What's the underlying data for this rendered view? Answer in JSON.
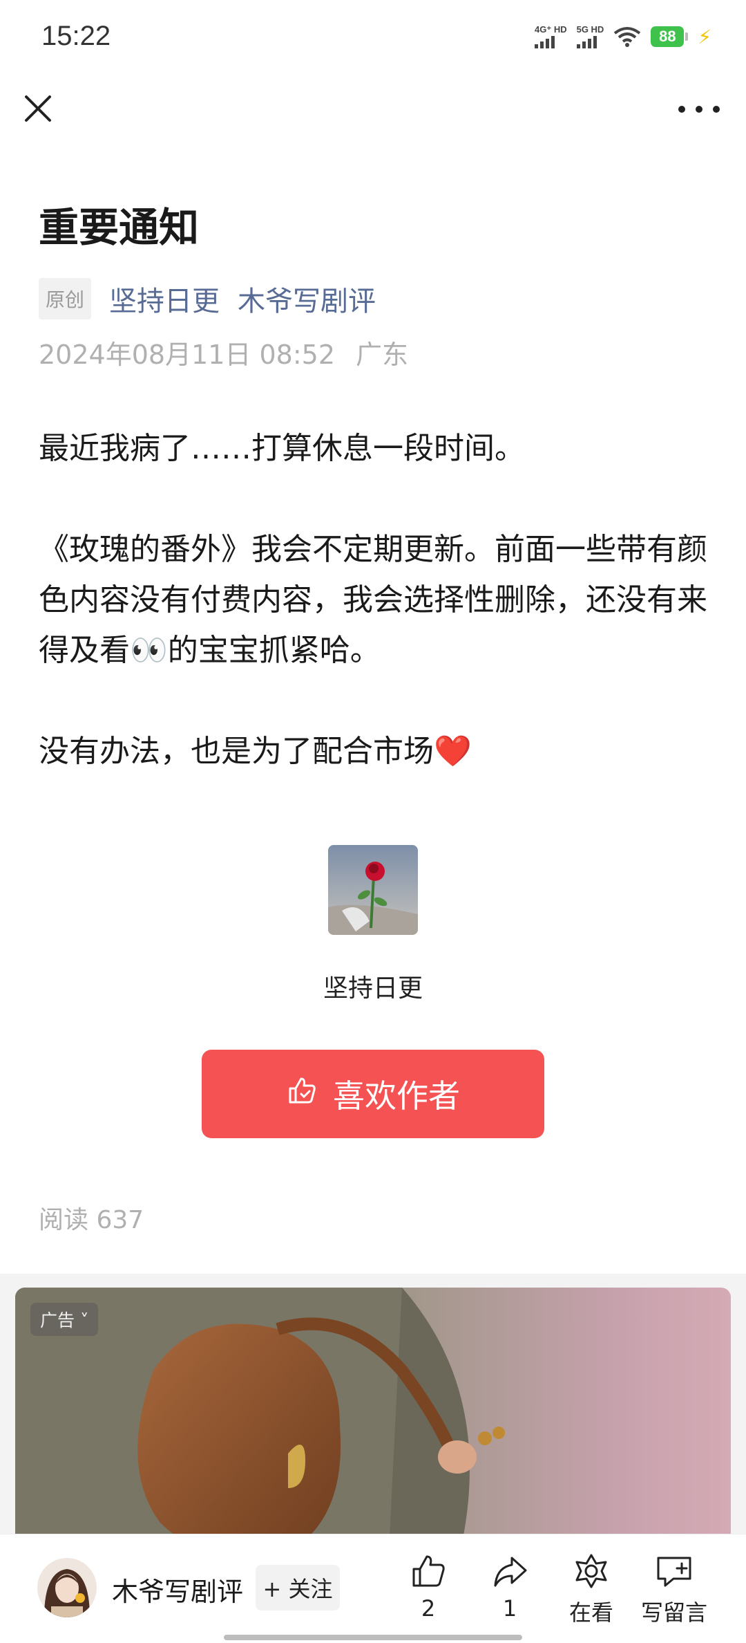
{
  "status_bar": {
    "time": "15:22",
    "signal1_label": "4G⁺ HD",
    "signal2_label": "5G HD",
    "battery": "88",
    "icons": [
      "signal-icon",
      "signal-icon",
      "wifi-icon",
      "battery-icon",
      "charging-icon"
    ]
  },
  "nav": {
    "icons": [
      "close-icon",
      "more-icon"
    ]
  },
  "article": {
    "title": "重要通知",
    "original_tag": "原创",
    "column_link": "坚持日更",
    "author_link": "木爷写剧评",
    "date": "2024年08月11日 08:52",
    "location": "广东",
    "paragraphs": [
      "最近我病了……打算休息一段时间。",
      "《玫瑰的番外》我会不定期更新。前面一些带有颜色内容没有付费内容，我会选择性删除，还没有来得及看👀的宝宝抓紧哈。",
      "没有办法，也是为了配合市场❤️"
    ],
    "sticker_caption": "坚持日更",
    "like_author_button": "喜欢作者",
    "read_label": "阅读 637"
  },
  "ad": {
    "badge": "广告"
  },
  "bottom_bar": {
    "author_name": "木爷写剧评",
    "follow_button": "+ 关注",
    "like_count": "2",
    "share_count": "1",
    "wow_label": "在看",
    "comment_label": "写留言"
  },
  "colors": {
    "accent_red": "#f55353",
    "link_blue": "#576b95",
    "muted_gray": "#b0b0b0",
    "battery_green": "#3fc24c"
  }
}
